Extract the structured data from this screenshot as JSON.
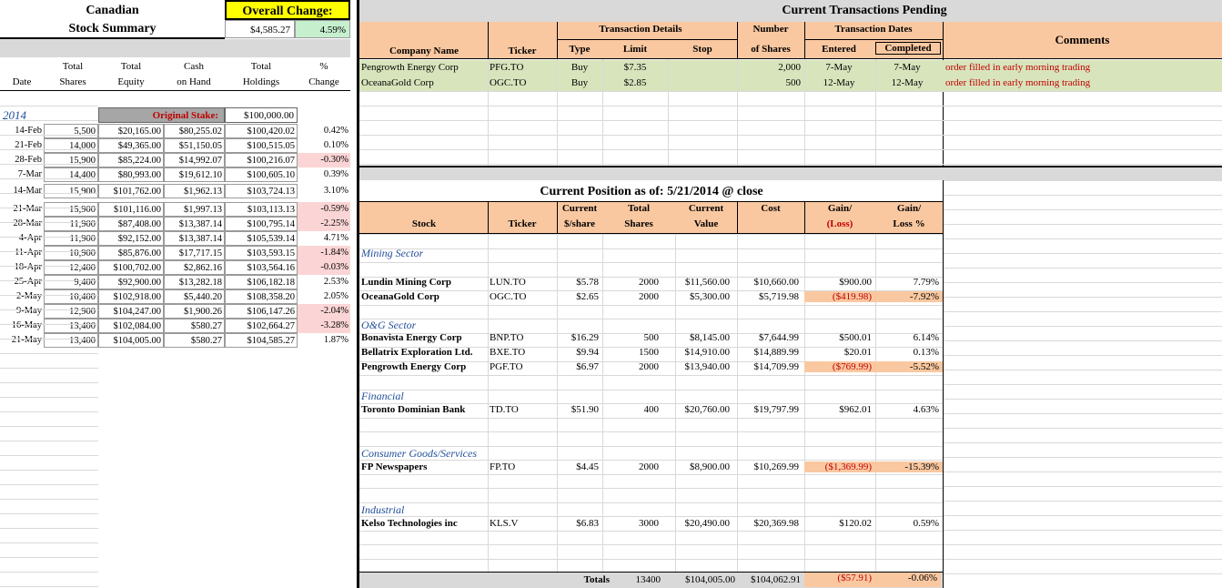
{
  "summary": {
    "title_line1": "Canadian",
    "title_line2": "Stock Summary",
    "overall_change_label": "Overall Change:",
    "overall_change_value": "$4,585.27",
    "overall_change_pct": "4.59%",
    "col_headers": {
      "date": "Date",
      "total_shares_1": "Total",
      "total_shares_2": "Shares",
      "total_equity_1": "Total",
      "total_equity_2": "Equity",
      "cash_1": "Cash",
      "cash_2": "on Hand",
      "holdings_1": "Total",
      "holdings_2": "Holdings",
      "change_1": "%",
      "change_2": "Change"
    },
    "year": "2014",
    "original_stake_label": "Original Stake:",
    "original_stake_value": "$100,000.00",
    "rows": [
      {
        "date": "14-Feb",
        "shares": "5,500",
        "equity": "$20,165.00",
        "cash": "$80,255.02",
        "holdings": "$100,420.02",
        "change": "0.42%",
        "neg": false
      },
      {
        "date": "21-Feb",
        "shares": "14,000",
        "equity": "$49,365.00",
        "cash": "$51,150.05",
        "holdings": "$100,515.05",
        "change": "0.10%",
        "neg": false
      },
      {
        "date": "28-Feb",
        "shares": "15,900",
        "equity": "$85,224.00",
        "cash": "$14,992.07",
        "holdings": "$100,216.07",
        "change": "-0.30%",
        "neg": true
      },
      {
        "date": "7-Mar",
        "shares": "14,400",
        "equity": "$80,993.00",
        "cash": "$19,612.10",
        "holdings": "$100,605.10",
        "change": "0.39%",
        "neg": false
      },
      {
        "date": "14-Mar",
        "shares": "15,900",
        "equity": "$101,762.00",
        "cash": "$1,962.13",
        "holdings": "$103,724.13",
        "change": "3.10%",
        "neg": false
      },
      {
        "date": "21-Mar",
        "shares": "15,900",
        "equity": "$101,116.00",
        "cash": "$1,997.13",
        "holdings": "$103,113.13",
        "change": "-0.59%",
        "neg": true
      },
      {
        "date": "28-Mar",
        "shares": "11,900",
        "equity": "$87,408.00",
        "cash": "$13,387.14",
        "holdings": "$100,795.14",
        "change": "-2.25%",
        "neg": true
      },
      {
        "date": "4-Apr",
        "shares": "11,900",
        "equity": "$92,152.00",
        "cash": "$13,387.14",
        "holdings": "$105,539.14",
        "change": "4.71%",
        "neg": false
      },
      {
        "date": "11-Apr",
        "shares": "10,900",
        "equity": "$85,876.00",
        "cash": "$17,717.15",
        "holdings": "$103,593.15",
        "change": "-1.84%",
        "neg": true
      },
      {
        "date": "18-Apr",
        "shares": "12,400",
        "equity": "$100,702.00",
        "cash": "$2,862.16",
        "holdings": "$103,564.16",
        "change": "-0.03%",
        "neg": true
      },
      {
        "date": "25-Apr",
        "shares": "9,400",
        "equity": "$92,900.00",
        "cash": "$13,282.18",
        "holdings": "$106,182.18",
        "change": "2.53%",
        "neg": false
      },
      {
        "date": "2-May",
        "shares": "10,400",
        "equity": "$102,918.00",
        "cash": "$5,440.20",
        "holdings": "$108,358.20",
        "change": "2.05%",
        "neg": false
      },
      {
        "date": "9-May",
        "shares": "12,900",
        "equity": "$104,247.00",
        "cash": "$1,900.26",
        "holdings": "$106,147.26",
        "change": "-2.04%",
        "neg": true
      },
      {
        "date": "16-May",
        "shares": "13,400",
        "equity": "$102,084.00",
        "cash": "$580.27",
        "holdings": "$102,664.27",
        "change": "-3.28%",
        "neg": true
      },
      {
        "date": "21-May",
        "shares": "13,400",
        "equity": "$104,005.00",
        "cash": "$580.27",
        "holdings": "$104,585.27",
        "change": "1.87%",
        "neg": false
      }
    ]
  },
  "pending": {
    "title": "Current Transactions Pending",
    "group_transaction_details": "Transaction Details",
    "group_number": "Number",
    "group_dates": "Transaction Dates",
    "comments_header": "Comments",
    "headers": {
      "company": "Company Name",
      "ticker": "Ticker",
      "type": "Type",
      "limit": "Limit",
      "stop": "Stop",
      "shares": "of Shares",
      "entered": "Entered",
      "completed": "Completed"
    },
    "rows": [
      {
        "company": "Pengrowth Energy Corp",
        "ticker": "PFG.TO",
        "type": "Buy",
        "limit": "$7.35",
        "stop": "",
        "shares": "2,000",
        "entered": "7-May",
        "completed": "7-May",
        "comment": "order filled in early morning trading"
      },
      {
        "company": "OceanaGold Corp",
        "ticker": "OGC.TO",
        "type": "Buy",
        "limit": "$2.85",
        "stop": "",
        "shares": "500",
        "entered": "12-May",
        "completed": "12-May",
        "comment": "order filled in early morning trading"
      }
    ]
  },
  "position": {
    "title": "Current Position as of: 5/21/2014  @ close",
    "headers": {
      "stock": "Stock",
      "ticker": "Ticker",
      "price_1": "Current",
      "price_2": "$/share",
      "shares_1": "Total",
      "shares_2": "Shares",
      "value_1": "Current",
      "value_2": "Value",
      "cost": "Cost",
      "gain_1": "Gain/",
      "gain_2": "(Loss)",
      "gainpct_1": "Gain/",
      "gainpct_2": "Loss %"
    },
    "sectors": [
      {
        "name": "Mining Sector",
        "rows": [
          {
            "stock": "Lundin Mining Corp",
            "ticker": "LUN.TO",
            "price": "$5.78",
            "shares": "2000",
            "value": "$11,560.00",
            "cost": "$10,660.00",
            "gain": "$900.00",
            "gainpct": "7.79%",
            "loss": false
          },
          {
            "stock": "OceanaGold Corp",
            "ticker": "OGC.TO",
            "price": "$2.65",
            "shares": "2000",
            "value": "$5,300.00",
            "cost": "$5,719.98",
            "gain": "($419.98)",
            "gainpct": "-7.92%",
            "loss": true
          }
        ]
      },
      {
        "name": "O&G Sector",
        "rows": [
          {
            "stock": "Bonavista Energy Corp",
            "ticker": "BNP.TO",
            "price": "$16.29",
            "shares": "500",
            "value": "$8,145.00",
            "cost": "$7,644.99",
            "gain": "$500.01",
            "gainpct": "6.14%",
            "loss": false
          },
          {
            "stock": "Bellatrix Exploration Ltd.",
            "ticker": "BXE.TO",
            "price": "$9.94",
            "shares": "1500",
            "value": "$14,910.00",
            "cost": "$14,889.99",
            "gain": "$20.01",
            "gainpct": "0.13%",
            "loss": false
          },
          {
            "stock": "Pengrowth Energy Corp",
            "ticker": "PGF.TO",
            "price": "$6.97",
            "shares": "2000",
            "value": "$13,940.00",
            "cost": "$14,709.99",
            "gain": "($769.99)",
            "gainpct": "-5.52%",
            "loss": true
          }
        ]
      },
      {
        "name": "Financial",
        "rows": [
          {
            "stock": "Toronto Dominian Bank",
            "ticker": "TD.TO",
            "price": "$51.90",
            "shares": "400",
            "value": "$20,760.00",
            "cost": "$19,797.99",
            "gain": "$962.01",
            "gainpct": "4.63%",
            "loss": false
          }
        ]
      },
      {
        "name": "Consumer Goods/Services",
        "rows": [
          {
            "stock": "FP Newspapers",
            "ticker": "FP.TO",
            "price": "$4.45",
            "shares": "2000",
            "value": "$8,900.00",
            "cost": "$10,269.99",
            "gain": "($1,369.99)",
            "gainpct": "-15.39%",
            "loss": true
          }
        ]
      },
      {
        "name": "Industrial",
        "rows": [
          {
            "stock": "Kelso Technologies inc",
            "ticker": "KLS.V",
            "price": "$6.83",
            "shares": "3000",
            "value": "$20,490.00",
            "cost": "$20,369.98",
            "gain": "$120.02",
            "gainpct": "0.59%",
            "loss": false
          }
        ]
      }
    ],
    "totals": {
      "label": "Totals",
      "shares": "13400",
      "value": "$104,005.00",
      "cost": "$104,062.91",
      "gain": "($57.91)",
      "gainpct": "-0.06%"
    }
  },
  "colors": {
    "peach": "#fac8a0",
    "green": "#d8e4bc",
    "yellow": "#ffff00",
    "pink": "#fbd5d5",
    "gray": "#d9d9d9",
    "red": "#c00000",
    "blue": "#1f4e99"
  }
}
